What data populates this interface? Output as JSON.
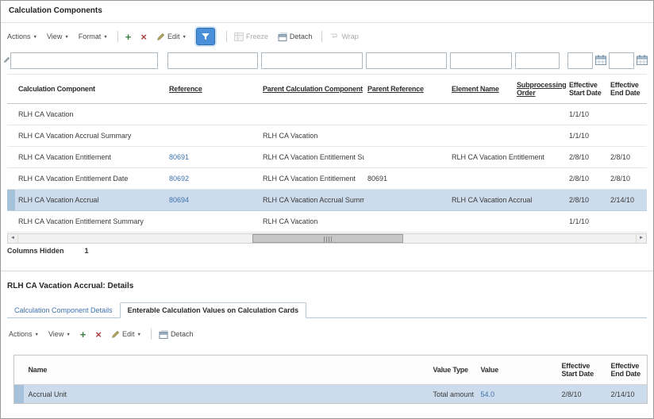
{
  "window": {
    "title": "Calculation Components"
  },
  "toolbar_labels": {
    "actions": "Actions",
    "view": "View",
    "format": "Format",
    "edit": "Edit",
    "freeze": "Freeze",
    "detach": "Detach",
    "wrap": "Wrap"
  },
  "icons": {
    "caret": "▼",
    "scroll_left": "◄",
    "scroll_right": "►"
  },
  "colors": {
    "selected_row": "#cddcec",
    "link": "#3d72ae",
    "qbe_active_button": "#4a90d9"
  },
  "components_table": {
    "columns": [
      "Calculation Component",
      "Reference",
      "Parent Calculation Component",
      "Parent Reference",
      "Element Name",
      "Subprocessing Order",
      "Effective Start Date",
      "Effective End Date"
    ],
    "rows": [
      [
        "RLH CA Vacation",
        "",
        "",
        "",
        "",
        "",
        "1/1/10",
        ""
      ],
      [
        "RLH CA Vacation Accrual Summary",
        "",
        "RLH CA Vacation",
        "",
        "",
        "",
        "1/1/10",
        ""
      ],
      [
        "RLH CA Vacation Entitlement",
        "80691",
        "RLH CA Vacation Entitlement Summary",
        "",
        "RLH CA Vacation Entitlement",
        "",
        "2/8/10",
        "2/8/10"
      ],
      [
        "RLH CA Vacation Entitlement Date",
        "80692",
        "RLH CA Vacation Entitlement",
        "80691",
        "",
        "",
        "2/8/10",
        "2/8/10"
      ],
      [
        "RLH CA Vacation Accrual",
        "80694",
        "RLH CA Vacation Accrual Summary",
        "",
        "RLH CA Vacation Accrual",
        "",
        "2/8/10",
        "2/14/10"
      ],
      [
        "RLH CA Vacation Entitlement Summary",
        "",
        "RLH CA Vacation",
        "",
        "",
        "",
        "1/1/10",
        ""
      ]
    ],
    "selected_row_index": 4
  },
  "columns_hidden": {
    "label": "Columns Hidden",
    "count": "1"
  },
  "details": {
    "title": "RLH CA Vacation Accrual: Details",
    "tabs": [
      "Calculation Component Details",
      "Enterable Calculation Values on Calculation Cards"
    ],
    "active_tab": "Enterable Calculation Values on Calculation Cards",
    "values_table": {
      "columns": [
        "Name",
        "Value Type",
        "Value",
        "Effective Start Date",
        "Effective End Date"
      ],
      "rows": [
        [
          "Accrual Unit",
          "Total amount",
          "54.0",
          "2/8/10",
          "2/14/10"
        ]
      ]
    }
  }
}
